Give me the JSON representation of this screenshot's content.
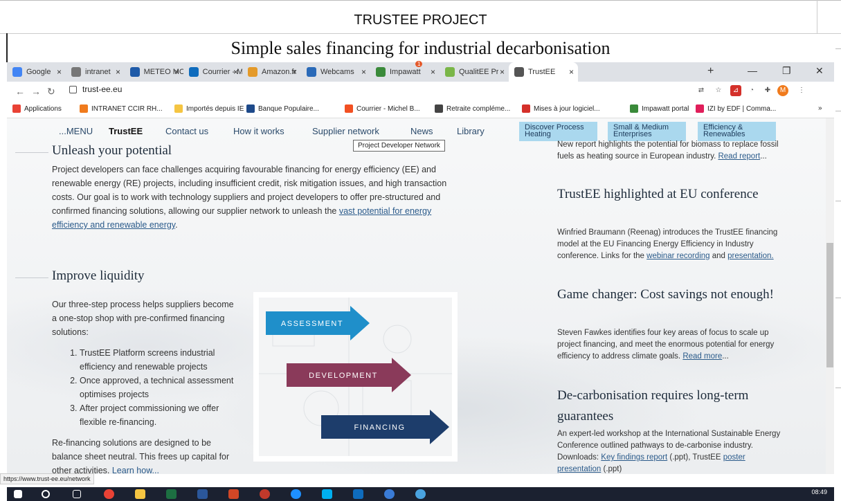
{
  "slide": {
    "title": "TRUSTEE PROJECT",
    "subtitle": "Simple sales financing for industrial decarbonisation"
  },
  "browser": {
    "tabs": [
      {
        "label": "Google",
        "icon": "google-icon",
        "color": "#4285f4"
      },
      {
        "label": "intranet",
        "icon": "globe-icon",
        "color": "#777777"
      },
      {
        "label": "METEO MC",
        "icon": "meteo-icon",
        "color": "#1e5aa8"
      },
      {
        "label": "Courrier - M",
        "icon": "outlook-icon",
        "color": "#0f6cbd"
      },
      {
        "label": "Amazon.fr",
        "icon": "amazon-icon",
        "color": "#e49a2a"
      },
      {
        "label": "Webcams",
        "icon": "webcam-icon",
        "color": "#2a6ab8"
      },
      {
        "label": "Impawatt",
        "icon": "impawatt-icon",
        "color": "#3a8a3a",
        "badge": "1"
      },
      {
        "label": "QualitEE Pr",
        "icon": "qualitee-icon",
        "color": "#7ab648"
      },
      {
        "label": "TrustEE",
        "icon": "globe-icon",
        "color": "#555555"
      }
    ],
    "url": "trust-ee.eu",
    "bookmarks": [
      {
        "label": "Applications",
        "color": "#e94235"
      },
      {
        "label": "INTRANET CCIR RH...",
        "color": "#f07b1d"
      },
      {
        "label": "Importés depuis IE",
        "color": "#f5c542"
      },
      {
        "label": "Banque Populaire...",
        "color": "#1e4a8a"
      },
      {
        "label": "Courrier - Michel B...",
        "color": "#f25022"
      },
      {
        "label": "Retraite compléme...",
        "color": "#444444"
      },
      {
        "label": "Mises à jour logiciel...",
        "color": "#d4302a"
      },
      {
        "label": "Impawatt portal",
        "color": "#3a8a3a"
      },
      {
        "label": "IZI by EDF | Comma...",
        "color": "#e01e5a"
      }
    ],
    "bookmarks_more": "»",
    "status_url": "https://www.trust-ee.eu/network"
  },
  "site": {
    "nav": {
      "menu": "...MENU",
      "brand": "TrustEE",
      "items": [
        "Contact us",
        "How it works",
        "Supplier network",
        "News",
        "Library"
      ],
      "pills": [
        "Discover Process Heating",
        "Small & Medium Enterprises",
        "Efficiency & Renewables"
      ],
      "tooltip": "Project Developer Network"
    },
    "unleash": {
      "heading": "Unleash your potential",
      "text": "Project developers can face challenges acquiring favourable financing for energy efficiency (EE) and renewable energy (RE) projects, including insufficient credit, risk mitigation issues, and high transaction costs. Our goal is to work with technology suppliers and project developers to offer pre-structured and confirmed financing solutions, allowing our supplier network to unleash the ",
      "link": "vast potential for energy efficiency and renewable energy",
      "end": "."
    },
    "liquidity": {
      "heading": "Improve liquidity",
      "intro": "Our three-step process helps suppliers become a one-stop shop with pre-confirmed financing solutions:",
      "steps": [
        "TrustEE Platform screens industrial efficiency and renewable projects",
        "Once approved, a technical assessment optimises projects",
        "After project commissioning we offer flexible re-financing."
      ],
      "outro": "Re-financing solutions are designed to be balance sheet neutral. This frees up capital for other activities. ",
      "link": "Learn how...",
      "arrows": [
        {
          "label": "ASSESSMENT",
          "color": "#1f8fca"
        },
        {
          "label": "DEVELOPMENT",
          "color": "#8a3a5a"
        },
        {
          "label": "FINANCING",
          "color": "#1d3d6b"
        }
      ]
    },
    "news": [
      {
        "heading": "",
        "text": "New report highlights the potential for biomass to replace fossil fuels as heating source in European industry. ",
        "links": [
          "Read report"
        ],
        "tail": "..."
      },
      {
        "heading": "TrustEE highlighted at EU conference",
        "text": "Winfried Braumann (Reenag) introduces the TrustEE financing model at the EU Financing Energy Efficiency in Industry conference. Links for the ",
        "links": [
          "webinar recording",
          "presentation."
        ],
        "mid": " and "
      },
      {
        "heading": "Game changer: Cost savings not enough!",
        "text": "Steven Fawkes identifies four key areas of focus to scale up project financing, and meet the enormous potential for energy efficiency to address climate goals. ",
        "links": [
          "Read more"
        ],
        "tail": "..."
      },
      {
        "heading": "De-carbonisation requires long-term guarantees",
        "text": "An expert-led workshop at the International Sustainable Energy Conference outlined pathways to de-carbonise industry. Downloads: ",
        "links": [
          "Key findings report",
          "poster presentation"
        ],
        "mid": " (.ppt), TrustEE ",
        "tail": " (.ppt)"
      }
    ]
  },
  "taskbar": {
    "time": "08:49"
  }
}
